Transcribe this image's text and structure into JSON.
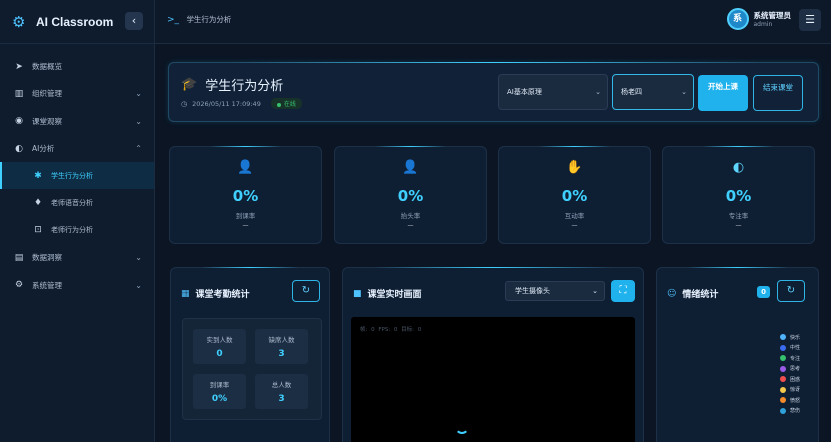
{
  "app": {
    "name": "AI Classroom"
  },
  "sidebar": {
    "items": [
      {
        "label": "数据概览",
        "icon": "rocket-icon"
      },
      {
        "label": "组织管理",
        "icon": "book-icon"
      },
      {
        "label": "课堂观察",
        "icon": "eye-icon"
      },
      {
        "label": "AI分析",
        "icon": "brain-icon"
      },
      {
        "label": "学生行为分析",
        "icon": "running-icon"
      },
      {
        "label": "老师语音分析",
        "icon": "microphone-icon"
      },
      {
        "label": "老师行为分析",
        "icon": "teacher-icon"
      },
      {
        "label": "数据洞察",
        "icon": "chart-icon"
      },
      {
        "label": "系统管理",
        "icon": "cogs-icon"
      }
    ]
  },
  "topbar": {
    "breadcrumb": "学生行为分析",
    "user": {
      "avatar": "系",
      "name": "系统管理员",
      "role": "admin"
    }
  },
  "header": {
    "title": "学生行为分析",
    "datetime": "2026/05/11 17:09:49",
    "status": "在线",
    "course": "AI基本原理",
    "teacher": "杨老四",
    "start_label": "开始上课",
    "end_label": "结束课堂"
  },
  "stats": [
    {
      "value": "0%",
      "label": "到课率",
      "detail": "—"
    },
    {
      "value": "0%",
      "label": "抬头率",
      "detail": "—"
    },
    {
      "value": "0%",
      "label": "互动率",
      "detail": "—"
    },
    {
      "value": "0%",
      "label": "专注率",
      "detail": "—"
    }
  ],
  "attendance": {
    "title": "课堂考勤统计",
    "actual_label": "实到人数",
    "actual": "0",
    "absent_label": "缺席人数",
    "absent": "3",
    "rate_label": "到课率",
    "rate": "0%",
    "total_label": "总人数",
    "total": "3"
  },
  "camera": {
    "title": "课堂实时画面",
    "source": "学生摄像头",
    "overlay": "帧: 0    FPS: 0    目标: 0"
  },
  "emotion": {
    "title": "情绪统计",
    "count": "0",
    "legend": [
      {
        "label": "快乐",
        "color": "#4fb3ff"
      },
      {
        "label": "中性",
        "color": "#3b6cf0"
      },
      {
        "label": "专注",
        "color": "#37c06d"
      },
      {
        "label": "思考",
        "color": "#9a5ce8"
      },
      {
        "label": "困惑",
        "color": "#f04e4e"
      },
      {
        "label": "惊讶",
        "color": "#f2c94c"
      },
      {
        "label": "愤怒",
        "color": "#f58a2a"
      },
      {
        "label": "悲伤",
        "color": "#2fa0d8"
      }
    ]
  }
}
